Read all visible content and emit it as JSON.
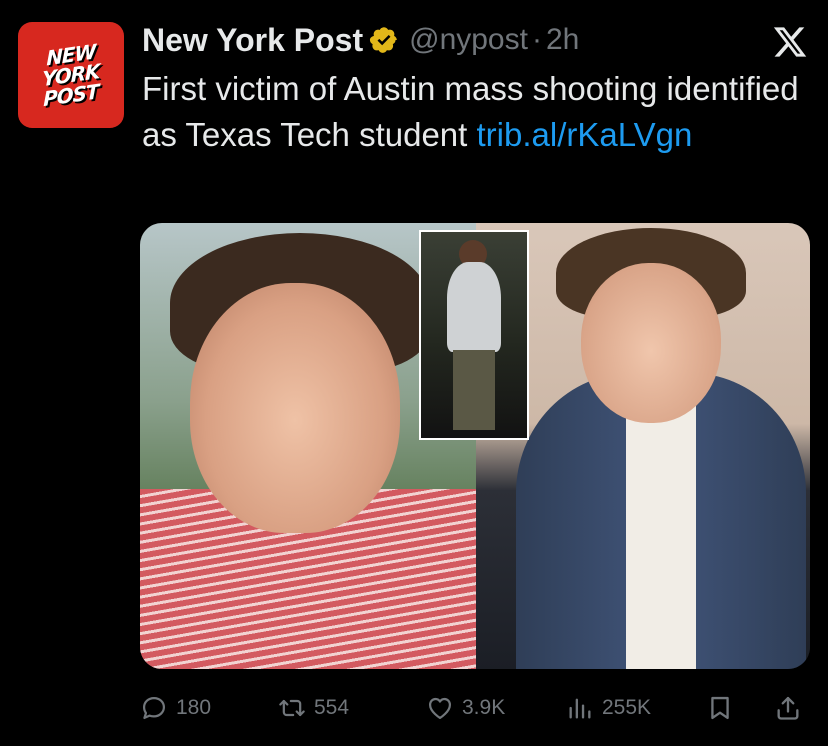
{
  "author": {
    "avatar_text": [
      "NEW",
      "YORK",
      "POST"
    ],
    "display_name": "New York Post",
    "verified": true,
    "handle": "@nypost",
    "separator": "·",
    "time": "2h"
  },
  "tweet": {
    "text": "First victim of Austin mass shooting identified as Texas Tech student ",
    "link": "trib.al/rKaLVgn"
  },
  "media": {
    "type": "photo-collage",
    "panels": 3
  },
  "actions": {
    "replies": "180",
    "reposts": "554",
    "likes": "3.9K",
    "views": "255K"
  },
  "colors": {
    "background": "#000000",
    "text": "#e7e9ea",
    "muted": "#71767b",
    "link": "#1d9bf0",
    "avatar_red": "#d7281f",
    "verified_gold": "#e2b719"
  },
  "icons": [
    "x-logo-icon",
    "verified-badge-icon",
    "reply-icon",
    "retweet-icon",
    "like-icon",
    "views-icon",
    "bookmark-icon",
    "share-icon"
  ]
}
